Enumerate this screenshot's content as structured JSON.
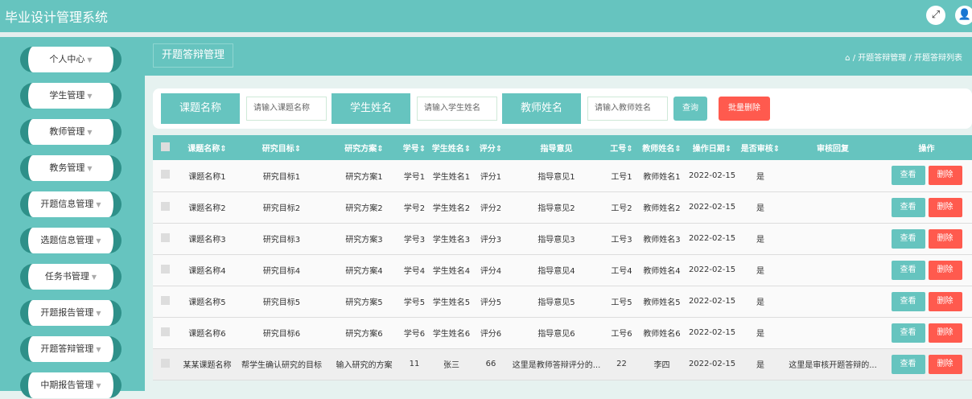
{
  "app": {
    "title": "毕业设计管理系统",
    "icons": [
      "fullscreen-icon",
      "user-icon"
    ]
  },
  "sidebar": {
    "items": [
      "个人中心",
      "学生管理",
      "教师管理",
      "教务管理",
      "开题信息管理",
      "选题信息管理",
      "任务书管理",
      "开题报告管理",
      "开题答辩管理",
      "中期报告管理"
    ]
  },
  "page": {
    "title": "开题答辩管理",
    "breadcrumb": [
      "开题答辩管理",
      "开题答辩列表"
    ]
  },
  "search": {
    "fields": [
      {
        "label": "课题名称",
        "placeholder": "请输入课题名称"
      },
      {
        "label": "学生姓名",
        "placeholder": "请输入学生姓名"
      },
      {
        "label": "教师姓名",
        "placeholder": "请输入教师姓名"
      }
    ],
    "query": "查询",
    "batch_delete": "批量删除"
  },
  "colors": {
    "primary": "#66c4bf",
    "danger": "#ff5a4e"
  },
  "table": {
    "headers": [
      "课题名称",
      "研究目标",
      "研究方案",
      "学号",
      "学生姓名",
      "评分",
      "指导意见",
      "工号",
      "教师姓名",
      "操作日期",
      "是否审核",
      "审核回复",
      "操作"
    ],
    "sortable": [
      true,
      true,
      true,
      true,
      true,
      true,
      false,
      true,
      true,
      true,
      true,
      false,
      false
    ],
    "view": "查看",
    "delete": "删除",
    "rows": [
      [
        "课题名称1",
        "研究目标1",
        "研究方案1",
        "学号1",
        "学生姓名1",
        "评分1",
        "指导意见1",
        "工号1",
        "教师姓名1",
        "2022-02-15",
        "是",
        ""
      ],
      [
        "课题名称2",
        "研究目标2",
        "研究方案2",
        "学号2",
        "学生姓名2",
        "评分2",
        "指导意见2",
        "工号2",
        "教师姓名2",
        "2022-02-15",
        "是",
        ""
      ],
      [
        "课题名称3",
        "研究目标3",
        "研究方案3",
        "学号3",
        "学生姓名3",
        "评分3",
        "指导意见3",
        "工号3",
        "教师姓名3",
        "2022-02-15",
        "是",
        ""
      ],
      [
        "课题名称4",
        "研究目标4",
        "研究方案4",
        "学号4",
        "学生姓名4",
        "评分4",
        "指导意见4",
        "工号4",
        "教师姓名4",
        "2022-02-15",
        "是",
        ""
      ],
      [
        "课题名称5",
        "研究目标5",
        "研究方案5",
        "学号5",
        "学生姓名5",
        "评分5",
        "指导意见5",
        "工号5",
        "教师姓名5",
        "2022-02-15",
        "是",
        ""
      ],
      [
        "课题名称6",
        "研究目标6",
        "研究方案6",
        "学号6",
        "学生姓名6",
        "评分6",
        "指导意见6",
        "工号6",
        "教师姓名6",
        "2022-02-15",
        "是",
        ""
      ],
      [
        "某某课题名称",
        "帮学生确认研究的目标",
        "输入研究的方案",
        "11",
        "张三",
        "66",
        "这里是教师答辩评分的...",
        "22",
        "李四",
        "2022-02-15",
        "是",
        "这里是审核开题答辩的..."
      ]
    ]
  }
}
